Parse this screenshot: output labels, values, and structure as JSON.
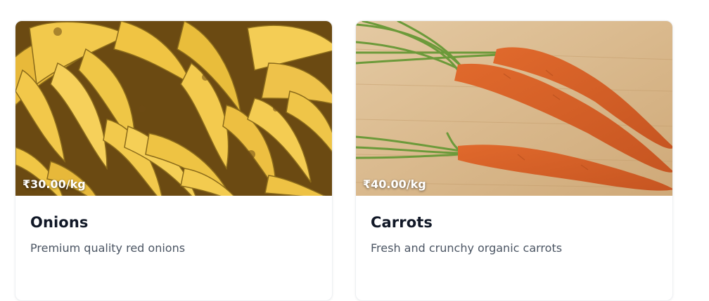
{
  "products": [
    {
      "name": "Onions",
      "description": "Premium quality red onions",
      "price": "₹30.00/kg",
      "image_icon": "bananas-photo"
    },
    {
      "name": "Carrots",
      "description": "Fresh and crunchy organic carrots",
      "price": "₹40.00/kg",
      "image_icon": "carrots-photo"
    }
  ],
  "colors": {
    "title": "#111827",
    "description": "#4b5563",
    "banana_yellow": "#f2c94c",
    "carrot_orange": "#d9652b",
    "board_wood": "#d8b98f"
  }
}
